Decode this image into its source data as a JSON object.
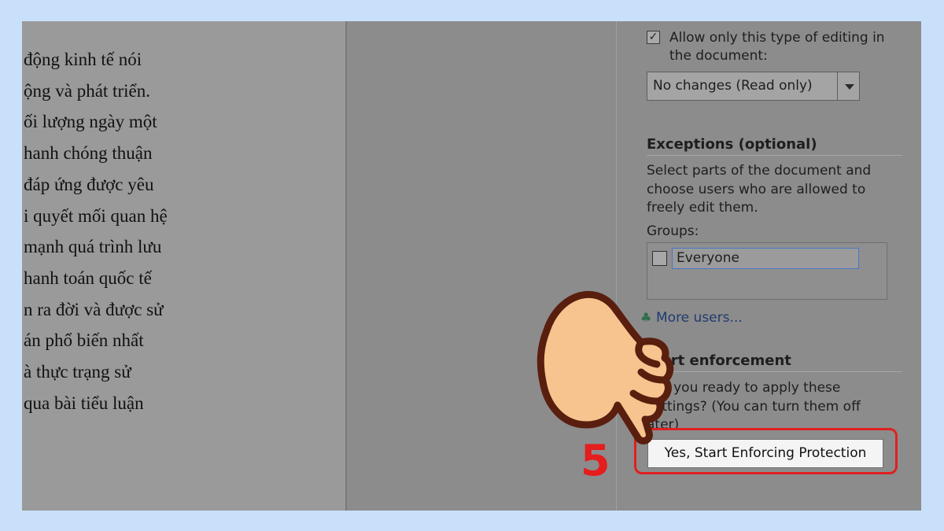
{
  "document": {
    "lines": [
      "động kinh tế nói",
      "ộng và phát triển.",
      "ối lượng ngày một",
      "hanh chóng thuận",
      "đáp ứng được yêu",
      "i quyết mối quan hệ",
      "mạnh quá trình lưu",
      "hanh toán quốc tế",
      "n ra đời và được sử",
      "án phổ biến nhất",
      "à thực trạng sử",
      "qua bài tiểu luận"
    ]
  },
  "pane": {
    "allow_editing_label": "Allow only this type of editing in the document:",
    "allow_editing_checked": true,
    "editing_type_value": "No changes (Read only)",
    "exceptions_title": "Exceptions (optional)",
    "exceptions_desc": "Select parts of the document and choose users who are allowed to freely edit them.",
    "groups_label": "Groups:",
    "groups": [
      {
        "name": "Everyone",
        "checked": false
      }
    ],
    "more_users_label": "More users...",
    "enforcement_title": "tart enforcement",
    "enforcement_desc": "Are you ready to apply these settings? (You can turn them off ater)",
    "enforce_button_label": "Yes, Start Enforcing Protection"
  },
  "annotation": {
    "step_number": "5",
    "highlight_color": "#e02020",
    "hand_icon": "pointing-hand-icon"
  },
  "colors": {
    "page_background": "#c9e0fb",
    "dim_overlay": "#8a8a8a"
  }
}
